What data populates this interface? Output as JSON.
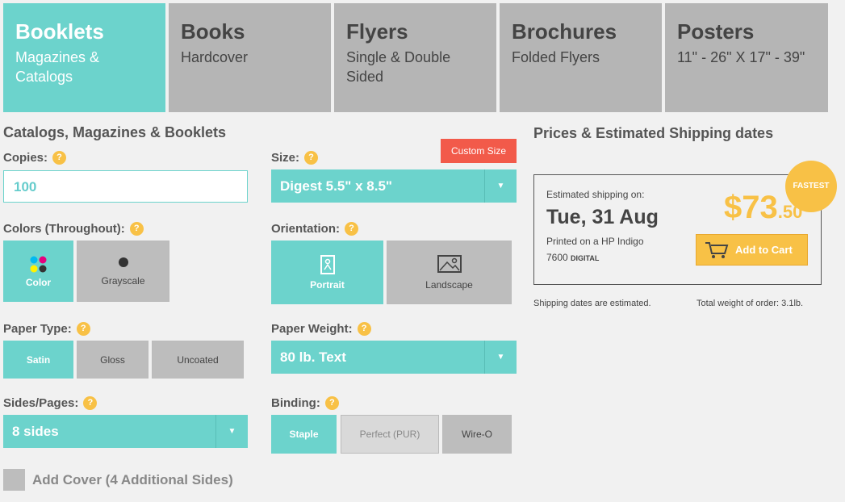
{
  "tabs": [
    {
      "title": "Booklets",
      "sub": "Magazines & Catalogs",
      "active": true
    },
    {
      "title": "Books",
      "sub": "Hardcover"
    },
    {
      "title": "Flyers",
      "sub": "Single & Double Sided"
    },
    {
      "title": "Brochures",
      "sub": "Folded Flyers"
    },
    {
      "title": "Posters",
      "sub": "11\" - 26\" X 17\" - 39\""
    }
  ],
  "form": {
    "section_title": "Catalogs, Magazines & Booklets",
    "help": "?",
    "copies_label": "Copies:",
    "copies_value": "100",
    "size_label": "Size:",
    "custom_size": "Custom Size",
    "size_value": "Digest 5.5\" x 8.5\"",
    "colors_label": "Colors (Throughout):",
    "color_option": "Color",
    "grayscale_option": "Grayscale",
    "orientation_label": "Orientation:",
    "portrait": "Portrait",
    "landscape": "Landscape",
    "paper_type_label": "Paper Type:",
    "paper_types": [
      "Satin",
      "Gloss",
      "Uncoated"
    ],
    "paper_weight_label": "Paper Weight:",
    "paper_weight_value": "80 lb. Text",
    "sides_label": "Sides/Pages:",
    "sides_value": "8 sides",
    "binding_label": "Binding:",
    "bindings": [
      "Staple",
      "Perfect (PUR)",
      "Wire-O"
    ],
    "add_cover": "Add Cover (4 Additional Sides)"
  },
  "pricing": {
    "title": "Prices & Estimated Shipping dates",
    "estimated_label": "Estimated shipping on:",
    "ship_date": "Tue, 31 Aug",
    "printed_on": "Printed on a HP Indigo",
    "printer_model": "7600",
    "printer_type": "DIGITAL",
    "fastest": "FASTEST",
    "price_dollars": "$73",
    "price_cents": ".50",
    "add_to_cart": "Add to Cart",
    "shipping_note": "Shipping dates are estimated.",
    "weight_note": "Total weight of order: 3.1lb."
  },
  "colors": {
    "accent": "#6cd3cc",
    "gold": "#f8c146",
    "red": "#f25a4a",
    "gray": "#b5b5b5"
  }
}
